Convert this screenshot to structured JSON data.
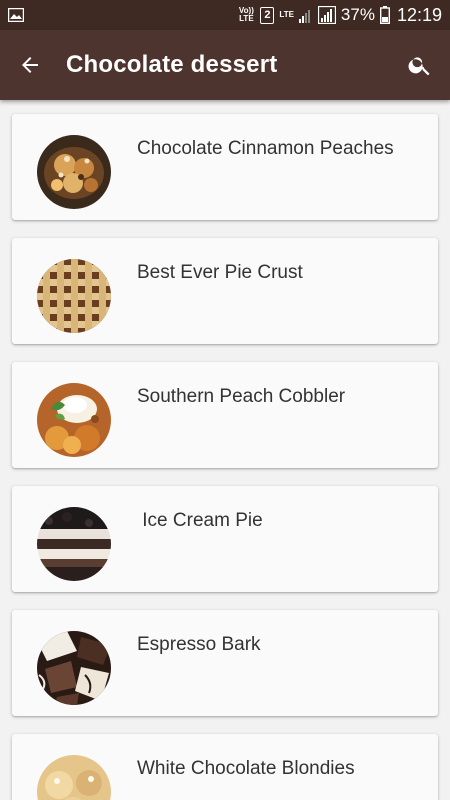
{
  "status_bar": {
    "volte_label": "Vo)) LTE",
    "sim_slot": "2",
    "network_label": "LTE",
    "battery_percent": "37%",
    "time": "12:19"
  },
  "app_bar": {
    "title": "Chocolate dessert"
  },
  "recipes": [
    {
      "title": "Chocolate Cinnamon Peaches",
      "image_icon": "peaches-photo"
    },
    {
      "title": "Best Ever Pie Crust",
      "image_icon": "pie-crust-photo"
    },
    {
      "title": "Southern Peach Cobbler",
      "image_icon": "cobbler-photo"
    },
    {
      "title": " Ice Cream Pie",
      "image_icon": "ice-cream-pie-photo"
    },
    {
      "title": "Espresso Bark",
      "image_icon": "espresso-bark-photo"
    },
    {
      "title": "White Chocolate Blondies",
      "image_icon": "blondies-photo"
    }
  ],
  "colors": {
    "status_bar": "#3e2a23",
    "app_bar": "#4e342e",
    "background": "#f2f2f2",
    "card": "#fafafa"
  }
}
